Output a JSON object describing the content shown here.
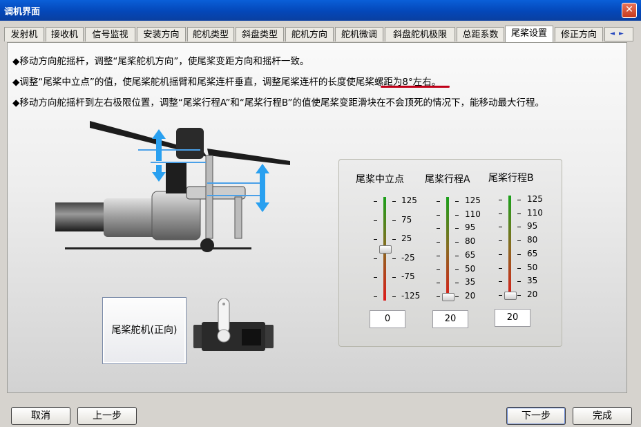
{
  "window": {
    "title": "调机界面",
    "close_label": "✕"
  },
  "tabs": [
    {
      "label": "发射机"
    },
    {
      "label": "接收机"
    },
    {
      "label": "信号监视"
    },
    {
      "label": "安装方向"
    },
    {
      "label": "舵机类型"
    },
    {
      "label": "斜盘类型"
    },
    {
      "label": "舵机方向"
    },
    {
      "label": "舵机微调"
    },
    {
      "label": "斜盘舵机极限"
    },
    {
      "label": "总距系数"
    },
    {
      "label": "尾桨设置",
      "active": true
    },
    {
      "label": "修正方向"
    }
  ],
  "tab_scroll": {
    "left_icon": "◄",
    "right_icon": "►"
  },
  "instructions": [
    "◆移动方向舵摇杆，调整“尾桨舵机方向”，使尾桨变距方向和摇杆一致。",
    "◆调整“尾桨中立点”的值，使尾桨舵机摇臂和尾桨连杆垂直，调整尾桨连杆的长度使尾桨螺距为8°左右。",
    "◆移动方向舵摇杆到左右极限位置，调整“尾桨行程A”和“尾桨行程B”的值使尾桨变距滑块在不会顶死的情况下，能移动最大行程。"
  ],
  "servo_direction_button": "尾桨舵机(正向)",
  "sliders": [
    {
      "title": "尾桨中立点",
      "ticks": [
        "125",
        "75",
        "25",
        "-25",
        "-75",
        "-125"
      ],
      "value": "0",
      "level": 0.5
    },
    {
      "title": "尾桨行程A",
      "ticks": [
        "125",
        "110",
        "95",
        "80",
        "65",
        "50",
        "35",
        "20"
      ],
      "value": "20",
      "level": 0.0
    },
    {
      "title": "尾桨行程B",
      "ticks": [
        "125",
        "110",
        "95",
        "80",
        "65",
        "50",
        "35",
        "20"
      ],
      "value": "20",
      "level": 0.0
    }
  ],
  "buttons": {
    "cancel": "取消",
    "prev": "上一步",
    "next": "下一步",
    "finish": "完成"
  },
  "colors": {
    "titlebar": "#0a5fd8",
    "accent_red": "#c00018",
    "track_top": "#1aa01a",
    "track_bottom": "#dd1a1a"
  }
}
